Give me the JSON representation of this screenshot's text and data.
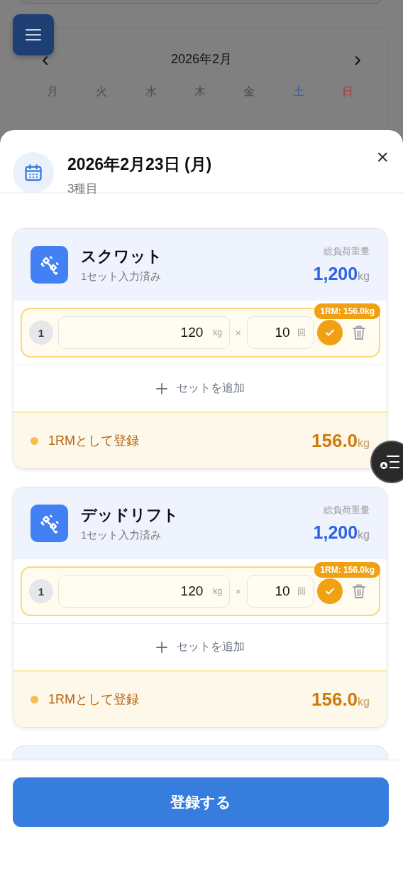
{
  "background": {
    "month_label": "2026年2月",
    "prev": "‹",
    "next": "›",
    "weekdays": [
      {
        "label": "月",
        "color": "#4a4a4a"
      },
      {
        "label": "火",
        "color": "#4a4a4a"
      },
      {
        "label": "水",
        "color": "#4a4a4a"
      },
      {
        "label": "木",
        "color": "#4a4a4a"
      },
      {
        "label": "金",
        "color": "#4a4a4a"
      },
      {
        "label": "土",
        "color": "#3a5a9a"
      },
      {
        "label": "日",
        "color": "#a03a3a"
      }
    ]
  },
  "sheet": {
    "title": "2026年2月23日 (月)",
    "subtitle": "3種目",
    "close": "×"
  },
  "exercises": [
    {
      "name": "スクワット",
      "status": "1セット入力済み",
      "total_label": "総負荷重量",
      "total_value": "1,200",
      "total_unit": "kg",
      "add_set_label": "セットを追加",
      "sets": [
        {
          "number": "1",
          "weight": "120",
          "weight_unit": "kg",
          "times": "×",
          "reps": "10",
          "reps_unit": "回",
          "done": true,
          "badge": "1RM: 156.0kg"
        }
      ],
      "one_rm": {
        "label": "1RMとして登録",
        "value": "156.0",
        "unit": "kg"
      }
    },
    {
      "name": "デッドリフト",
      "status": "1セット入力済み",
      "total_label": "総負荷重量",
      "total_value": "1,200",
      "total_unit": "kg",
      "add_set_label": "セットを追加",
      "sets": [
        {
          "number": "1",
          "weight": "120",
          "weight_unit": "kg",
          "times": "×",
          "reps": "10",
          "reps_unit": "回",
          "done": true,
          "badge": "1RM: 156.0kg"
        }
      ],
      "one_rm": {
        "label": "1RMとして登録",
        "value": "156.0",
        "unit": "kg"
      }
    }
  ],
  "submit_button": "登録する"
}
